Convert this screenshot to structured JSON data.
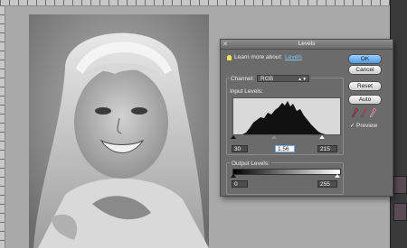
{
  "dialog": {
    "title": "Levels",
    "close_symbol": "✕",
    "learn_more_prefix": "Learn more about:",
    "learn_more_link": "Levels",
    "channel_label": "Channel:",
    "channel_value": "RGB",
    "input_levels_label": "Input Levels:",
    "input_black": "30",
    "input_gamma": "1.56",
    "input_white": "215",
    "output_levels_label": "Output Levels:",
    "output_black": "0",
    "output_white": "255",
    "buttons": {
      "ok": "OK",
      "cancel": "Cancel",
      "reset": "Reset",
      "auto": "Auto"
    },
    "preview_label": "Preview",
    "preview_checked": true,
    "eyedroppers": [
      "black-eyedropper-icon",
      "gray-eyedropper-icon",
      "white-eyedropper-icon"
    ]
  },
  "colors": {
    "link": "#7fc7ff",
    "primary_button": "#4c9ce8",
    "dialog_bg": "#6b6b6b",
    "canvas_bg": "#a9a9a9"
  }
}
